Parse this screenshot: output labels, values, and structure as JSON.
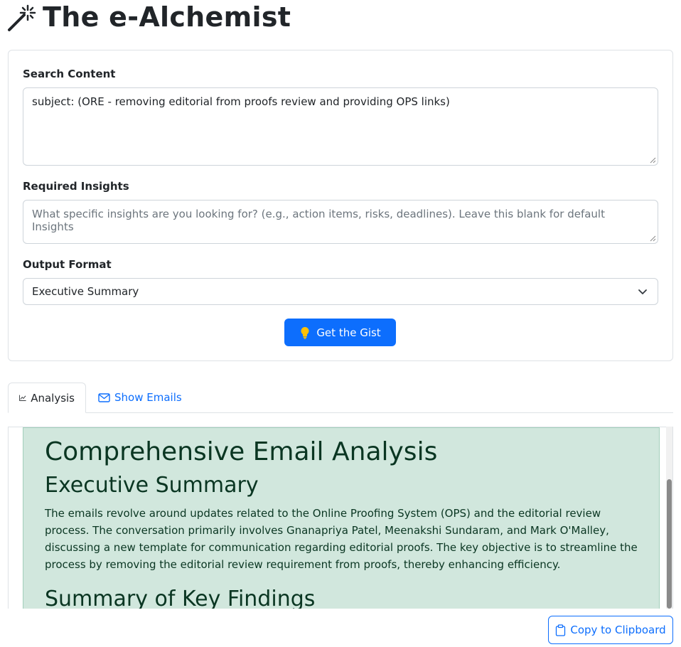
{
  "app": {
    "title": "The e-Alchemist",
    "title_icon": "magic-wand-icon"
  },
  "form": {
    "search_label": "Search Content",
    "search_value": "subject: (ORE - removing editorial from proofs review and providing OPS links)",
    "insights_label": "Required Insights",
    "insights_value": "",
    "insights_placeholder": "What specific insights are you looking for? (e.g., action items, risks, deadlines). Leave this blank for default Insights",
    "format_label": "Output Format",
    "format_selected": "Executive Summary",
    "submit_label": "Get the Gist",
    "submit_icon": "lightbulb-icon"
  },
  "tabs": [
    {
      "label": "Analysis",
      "icon": "graph-icon",
      "active": true
    },
    {
      "label": "Show Emails",
      "icon": "envelope-icon",
      "active": false
    }
  ],
  "result": {
    "heading": "Comprehensive Email Analysis",
    "section1_title": "Executive Summary",
    "section1_body": "The emails revolve around updates related to the Online Proofing System (OPS) and the editorial review process. The conversation primarily involves Gnanapriya Patel, Meenakshi Sundaram, and Mark O'Malley, discussing a new template for communication regarding editorial proofs. The key objective is to streamline the process by removing the editorial review requirement from proofs, thereby enhancing efficiency.",
    "section2_title": "Summary of Key Findings"
  },
  "copy_button": {
    "label": "Copy to Clipboard",
    "icon": "clipboard-icon"
  },
  "colors": {
    "primary": "#0d6efd",
    "success_bg": "#d1e7dd",
    "success_text": "#0a3622",
    "bulb": "#ffc107"
  }
}
